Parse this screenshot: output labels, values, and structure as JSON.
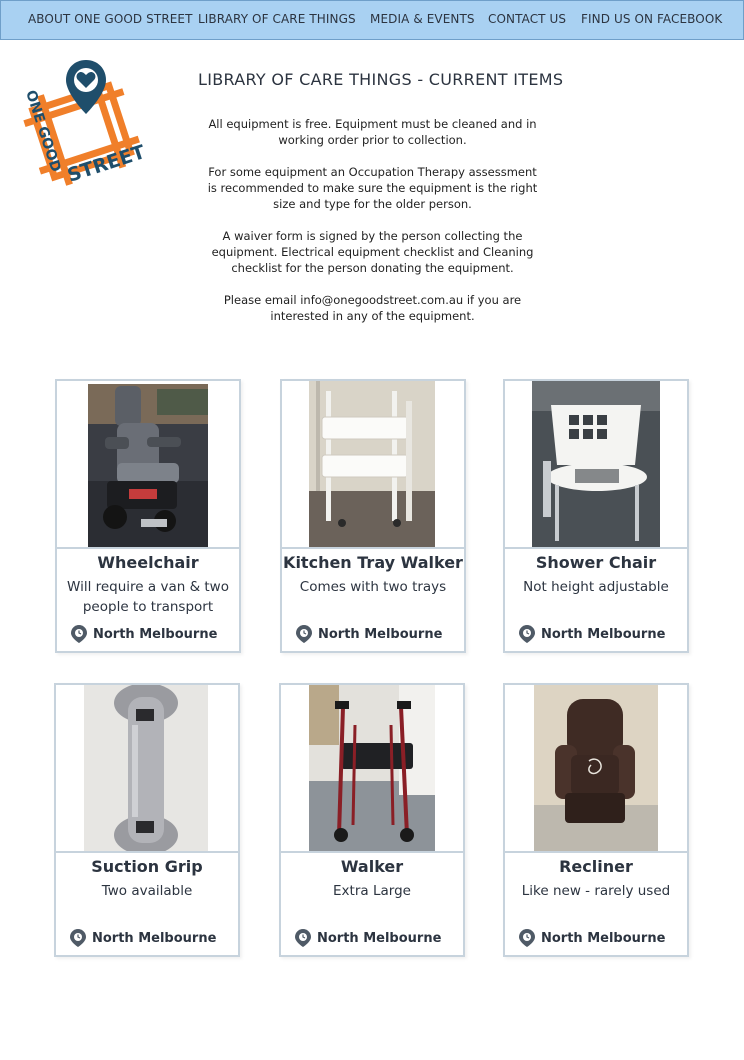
{
  "nav": {
    "items": [
      {
        "label": "ABOUT ONE GOOD STREET"
      },
      {
        "label": "LIBRARY OF CARE THINGS"
      },
      {
        "label": "MEDIA & EVENTS"
      },
      {
        "label": "CONTACT US"
      },
      {
        "label": "FIND US ON FACEBOOK"
      }
    ]
  },
  "logo": {
    "text_top": "ONE GOOD",
    "text_bottom": "STREET",
    "icon": "location-heart-icon",
    "accent": "#f07f2a",
    "dark": "#1f4e6b"
  },
  "page": {
    "title": "LIBRARY OF CARE THINGS - CURRENT ITEMS",
    "intro": [
      "All equipment is free. Equipment must be cleaned and in working order prior to collection.",
      "For some equipment an Occupation Therapy assessment is recommended to make sure the equipment is the right size and type for the older person.",
      "A waiver form is signed by the person collecting the equipment. Electrical equipment checklist and Cleaning checklist for the person donating the equipment.",
      "Please email info@onegoodstreet.com.au if you are interested in any of the equipment."
    ]
  },
  "items": [
    {
      "title": "Wheelchair",
      "desc": "Will require a van & two people to transport",
      "location": "North Melbourne",
      "icon": "wheelchair-photo"
    },
    {
      "title": "Kitchen Tray Walker",
      "desc": "Comes with two trays",
      "location": "North Melbourne",
      "icon": "tray-walker-photo"
    },
    {
      "title": "Shower Chair",
      "desc": "Not height adjustable",
      "location": "North Melbourne",
      "icon": "shower-chair-photo"
    },
    {
      "title": "Suction Grip",
      "desc": "Two available",
      "location": "North Melbourne",
      "icon": "suction-grip-photo"
    },
    {
      "title": "Walker",
      "desc": "Extra Large",
      "location": "North Melbourne",
      "icon": "walker-photo"
    },
    {
      "title": "Recliner",
      "desc": "Like new - rarely used",
      "location": "North Melbourne",
      "icon": "recliner-photo"
    }
  ]
}
